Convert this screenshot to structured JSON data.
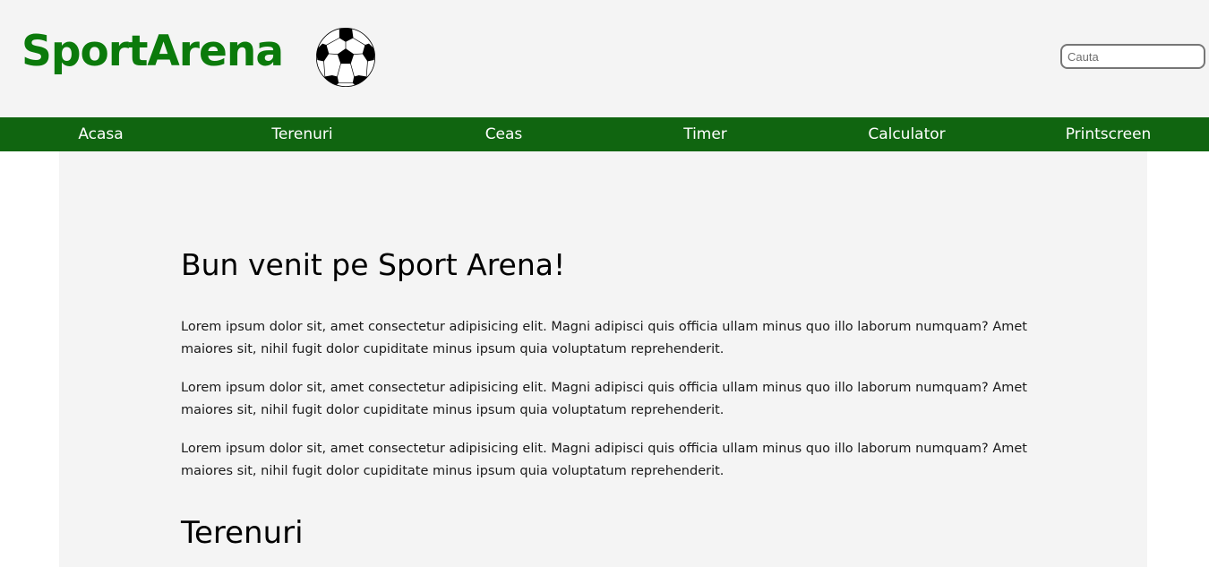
{
  "header": {
    "logo": "SportArena",
    "ball_icon": "soccer-ball-icon",
    "search_placeholder": "Cauta"
  },
  "nav": {
    "items": [
      {
        "label": "Acasa"
      },
      {
        "label": "Terenuri"
      },
      {
        "label": "Ceas"
      },
      {
        "label": "Timer"
      },
      {
        "label": "Calculator"
      },
      {
        "label": "Printscreen"
      }
    ]
  },
  "main": {
    "title": "Bun venit pe Sport Arena!",
    "paragraphs": [
      "Lorem ipsum dolor sit, amet consectetur adipisicing elit. Magni adipisci quis officia ullam minus quo illo laborum numquam? Amet maiores sit, nihil fugit dolor cupiditate minus ipsum quia voluptatum reprehenderit.",
      "Lorem ipsum dolor sit, amet consectetur adipisicing elit. Magni adipisci quis officia ullam minus quo illo laborum numquam? Amet maiores sit, nihil fugit dolor cupiditate minus ipsum quia voluptatum reprehenderit.",
      "Lorem ipsum dolor sit, amet consectetur adipisicing elit. Magni adipisci quis officia ullam minus quo illo laborum numquam? Amet maiores sit, nihil fugit dolor cupiditate minus ipsum quia voluptatum reprehenderit."
    ],
    "section_title": "Terenuri"
  },
  "colors": {
    "logo": "#0b7a0b",
    "nav_bg": "#106510",
    "header_bg": "#f4f4f4",
    "content_bg": "#f4f4f4"
  }
}
